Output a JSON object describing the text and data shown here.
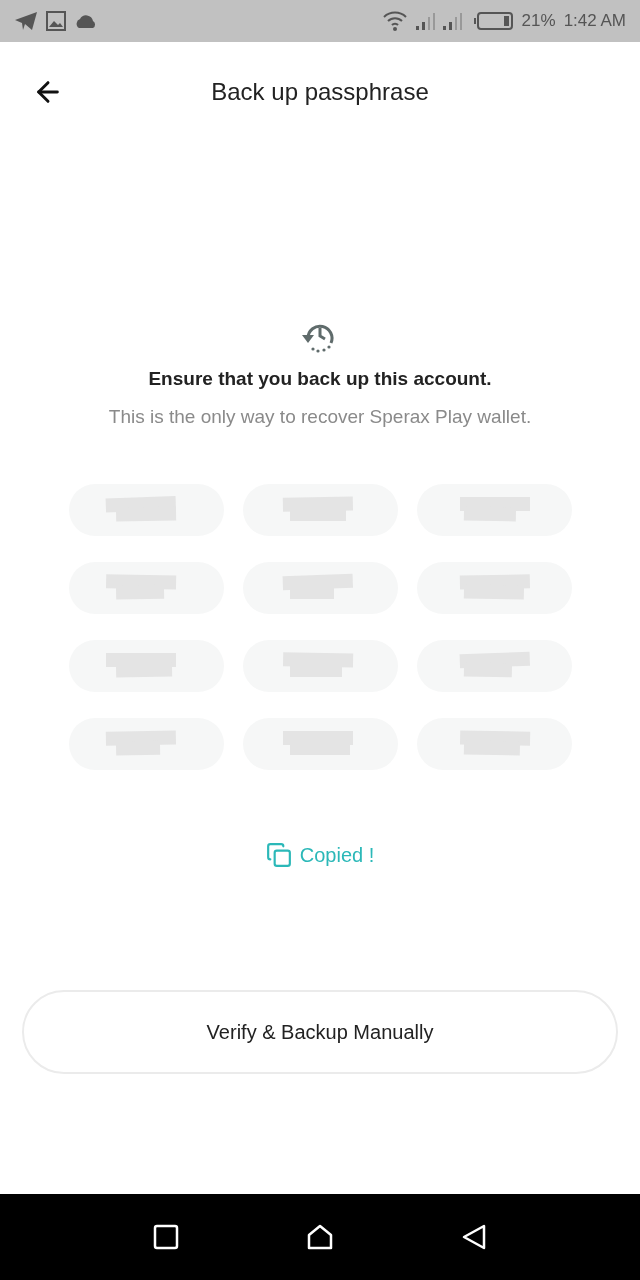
{
  "status_bar": {
    "battery": "21%",
    "time": "1:42 AM"
  },
  "header": {
    "title": "Back up passphrase"
  },
  "notice": {
    "heading": "Ensure that you back up this account.",
    "text": "This is the only way to recover Sperax Play wallet."
  },
  "words": [
    {
      "kind": "hidden"
    },
    {
      "kind": "hidden"
    },
    {
      "kind": "hidden"
    },
    {
      "kind": "hidden"
    },
    {
      "kind": "hidden"
    },
    {
      "kind": "hidden"
    },
    {
      "kind": "hidden"
    },
    {
      "kind": "hidden"
    },
    {
      "kind": "hidden"
    },
    {
      "kind": "hidden"
    },
    {
      "kind": "hidden"
    },
    {
      "kind": "hidden"
    }
  ],
  "copy_status": "Copied !",
  "button": "Verify & Backup Manually"
}
